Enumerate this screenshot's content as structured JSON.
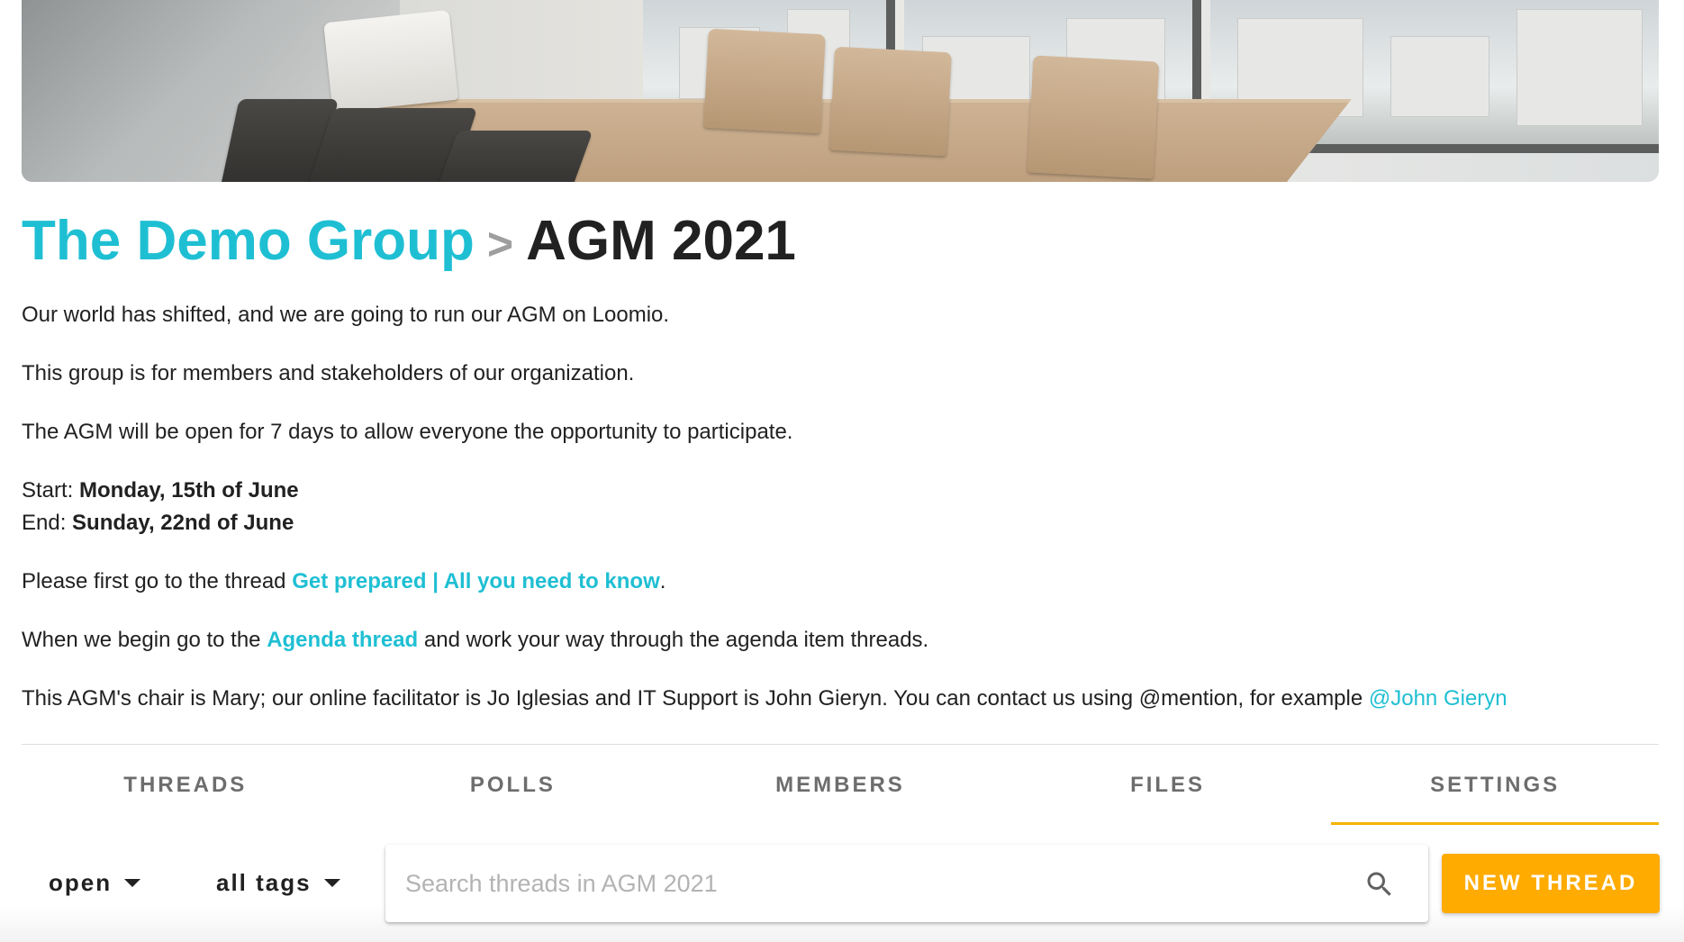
{
  "cover": {
    "image": "meeting-room-cover"
  },
  "breadcrumb": {
    "group": "The Demo Group",
    "separator": ">",
    "current": "AGM 2021"
  },
  "description": {
    "line1": "Our world has shifted, and we are going to run our AGM on Loomio.",
    "line2": "This group is for members and stakeholders of our organization.",
    "line3": "The AGM will be open for 7 days to allow everyone the opportunity to participate.",
    "start_label": "Start: ",
    "start_value": "Monday, 15th of June",
    "end_label": "End: ",
    "end_value": "Sunday, 22nd of June",
    "prepare_prefix": "Please first go to the thread ",
    "prepare_link": "Get prepared | All you need to know",
    "prepare_suffix": ".",
    "agenda_prefix": "When we begin go to the ",
    "agenda_link": "Agenda thread",
    "agenda_suffix": " and work your way through the agenda item threads.",
    "contact_text": "This AGM's chair is Mary; our online facilitator is Jo Iglesias and IT Support is John Gieryn. You can contact us using @mention, for example ",
    "contact_mention": "@John Gieryn"
  },
  "tabs": [
    {
      "label": "THREADS",
      "active": false
    },
    {
      "label": "POLLS",
      "active": false
    },
    {
      "label": "MEMBERS",
      "active": false
    },
    {
      "label": "FILES",
      "active": false
    },
    {
      "label": "SETTINGS",
      "active": true
    }
  ],
  "toolbar": {
    "status_filter": "open",
    "tag_filter": "all tags",
    "search_placeholder": "Search threads in AGM 2021",
    "search_value": "",
    "new_thread_label": "NEW THREAD"
  },
  "colors": {
    "link": "#1fbfd3",
    "accent": "#ffab00",
    "tab_indicator": "#f5b400",
    "text": "#212121",
    "muted": "#6d6d6d"
  },
  "icons": {
    "search": "search-icon",
    "dropdown": "caret-down-icon"
  }
}
